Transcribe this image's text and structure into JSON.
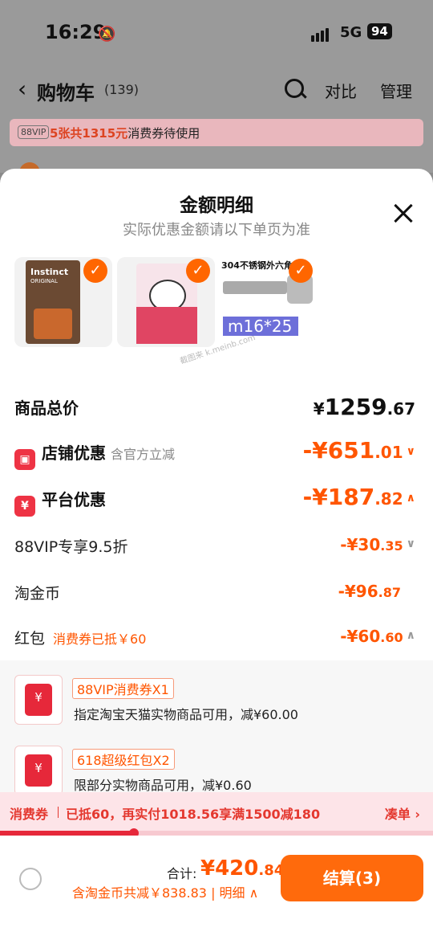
{
  "status": {
    "time": "16:29",
    "network": "5G",
    "battery": "94"
  },
  "nav": {
    "title": "购物车",
    "count": "(139)",
    "compare": "对比",
    "manage": "管理"
  },
  "vip": {
    "badge": "88VIP",
    "highlight": "5张共1315元",
    "text": "消费券待使用"
  },
  "sheet": {
    "title": "金额明细",
    "subtitle": "实际优惠金额请以下单页为准",
    "thumb1_brand": "Instinct",
    "thumb1_sub": "ORIGINAL",
    "thumb3_title": "304不锈钢外六角",
    "thumb3_size": "m16*25",
    "watermark": "截图来 k.meinb.com"
  },
  "rows": {
    "total": {
      "label": "商品总价",
      "amount_sym": "¥",
      "amount_big": "1259",
      "amount_small": ".67"
    },
    "store": {
      "label": "店铺优惠",
      "note": "含官方立减",
      "amount_big": "-¥651",
      "amount_small": ".01"
    },
    "platform": {
      "label": "平台优惠",
      "amount_big": "-¥187",
      "amount_small": ".82"
    },
    "vip95": {
      "label": "88VIP专享9.5折",
      "amount_big": "-¥30",
      "amount_small": ".35"
    },
    "gold": {
      "label": "淘金币",
      "amount_big": "-¥96",
      "amount_small": ".87"
    },
    "redpacket": {
      "label": "红包",
      "note": "消费券已抵￥60",
      "amount_big": "-¥60",
      "amount_small": ".60"
    }
  },
  "coupons": [
    {
      "tag": "88VIP消费券X1",
      "desc": "指定淘宝天猫实物商品可用，减¥60.00"
    },
    {
      "tag": "618超级红包X2",
      "desc": "限部分实物商品可用，减¥0.60"
    }
  ],
  "promo": {
    "label": "消费券",
    "text": "已抵60，再实付1018.56享满1500减180",
    "link": "凑单 ›",
    "progress": 0.31
  },
  "bottom": {
    "total_label": "合计:",
    "total_big": "¥420",
    "total_small": ".84",
    "saved": "含淘金币共减￥838.83 | 明细",
    "pay": "结算(3)"
  },
  "colors": {
    "accent": "#ff5500",
    "red": "#e6283a"
  }
}
